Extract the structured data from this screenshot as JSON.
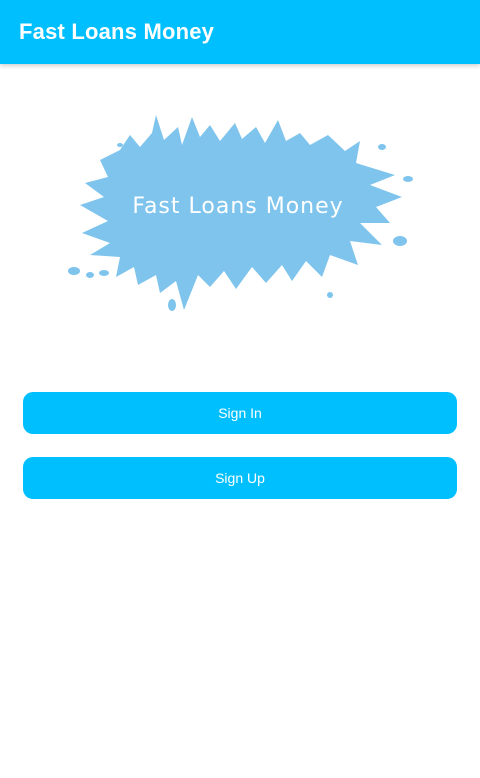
{
  "app_bar": {
    "title": "Fast Loans Money"
  },
  "logo": {
    "text": "Fast Loans Money",
    "splash_color": "#7fc4ec"
  },
  "buttons": {
    "sign_in": "Sign In",
    "sign_up": "Sign Up"
  },
  "colors": {
    "primary": "#00bfff",
    "background": "#ffffff",
    "text_on_primary": "#ffffff"
  }
}
